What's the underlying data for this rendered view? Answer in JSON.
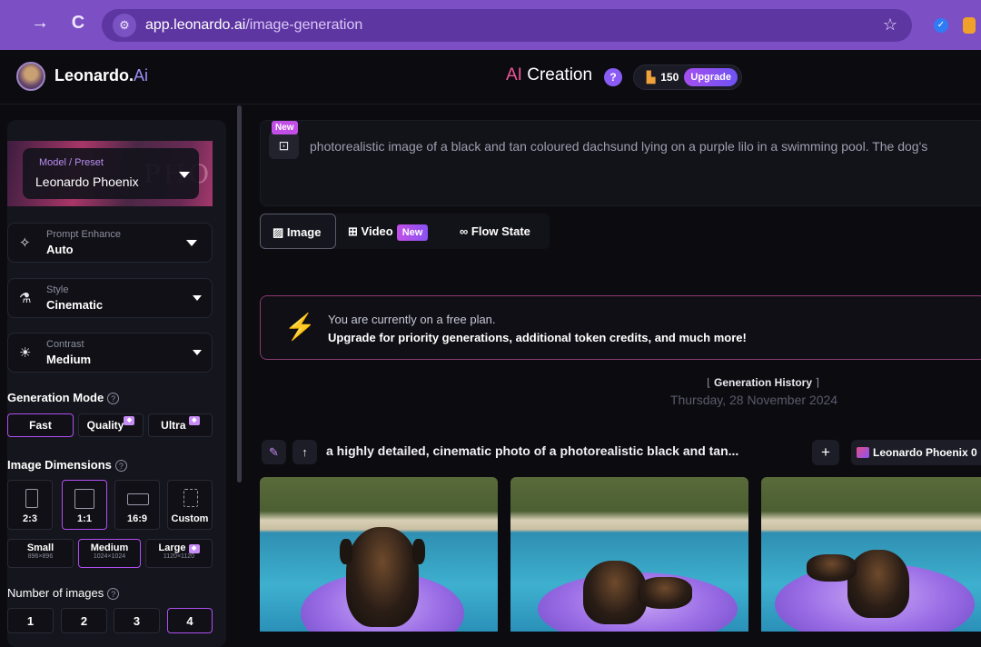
{
  "browser": {
    "url_host": "app.leonardo.ai",
    "url_path": "/image-generation",
    "nav_forward": "→",
    "nav_reload": "C"
  },
  "header": {
    "brand_name": "Leonardo.",
    "brand_ai": "Ai",
    "title_ai": "AI",
    "title_rest": " Creation",
    "help": "?",
    "tokens": "150",
    "upgrade": "Upgrade"
  },
  "sidebar": {
    "model": {
      "label": "Model / Preset",
      "value": "Leonardo Phoenix",
      "ghost": "PHOENIX"
    },
    "prompt_enhance": {
      "label": "Prompt Enhance",
      "value": "Auto"
    },
    "style": {
      "label": "Style",
      "value": "Cinematic"
    },
    "contrast": {
      "label": "Contrast",
      "value": "Medium"
    },
    "generation_mode": {
      "title": "Generation Mode",
      "options": [
        "Fast",
        "Quality",
        "Ultra"
      ],
      "selected": "Fast"
    },
    "image_dimensions": {
      "title": "Image Dimensions",
      "ratios": [
        "2:3",
        "1:1",
        "16:9",
        "Custom"
      ],
      "selected_ratio": "1:1",
      "sizes": [
        {
          "label": "Small",
          "dims": "896×896"
        },
        {
          "label": "Medium",
          "dims": "1024×1024"
        },
        {
          "label": "Large",
          "dims": "1120×1120"
        }
      ],
      "selected_size": "Medium"
    },
    "number_of_images": {
      "title": "Number of images",
      "options": [
        "1",
        "2",
        "3",
        "4"
      ],
      "selected": "4"
    }
  },
  "main": {
    "prompt_new_badge": "New",
    "prompt_text": "photorealistic image of a black and tan coloured dachsund lying on a purple lilo in a swimming pool. The dog's",
    "tabs": [
      {
        "label": "Image"
      },
      {
        "label": "Video",
        "badge": "New"
      },
      {
        "label": "Flow State"
      }
    ],
    "notice": {
      "line1": "You are currently on a free plan.",
      "line2": "Upgrade for priority generations, additional token credits, and much more!"
    },
    "history": {
      "title": "Generation History",
      "date": "Thursday, 28 November 2024"
    },
    "generation": {
      "prompt": "a highly detailed, cinematic photo of a photorealistic black and tan...",
      "plus": "+",
      "model_chip": "Leonardo Phoenix 0"
    }
  }
}
